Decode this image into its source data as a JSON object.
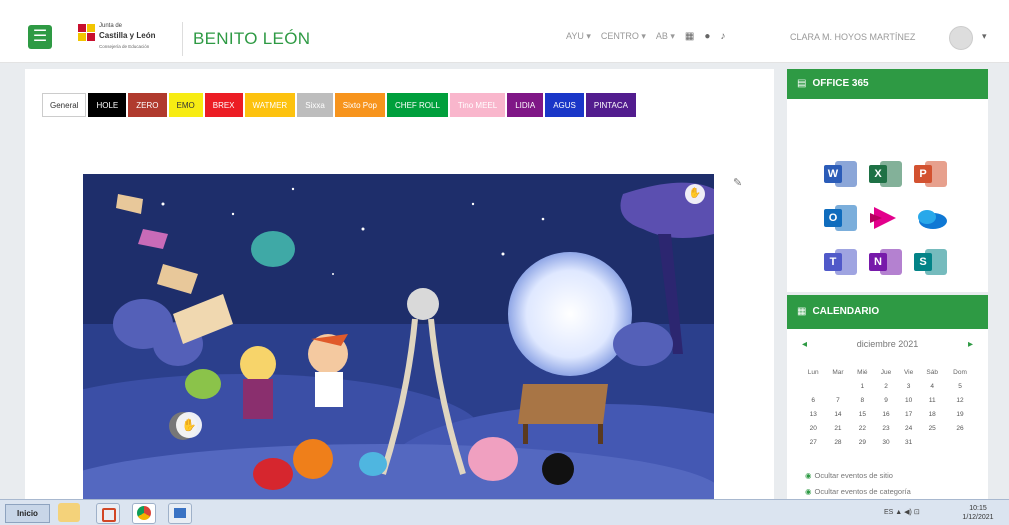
{
  "header": {
    "menu_icon": "hamburger-icon",
    "logo_lines": [
      "Junta de",
      "Castilla y León",
      "Consejería de Educación"
    ],
    "site_title": "BENITO LEÓN",
    "nav_items": [
      "AYU ▾",
      "CENTRO ▾",
      "AB ▾"
    ],
    "nav_icons": [
      "grid-icon",
      "chat-icon",
      "bell-icon"
    ],
    "user_name": "CLARA M. HOYOS MARTÍNEZ",
    "user_caret": "▾"
  },
  "tabs": [
    {
      "label": "General",
      "bg": "#ffffff",
      "fg": "#333333",
      "active": true
    },
    {
      "label": "HOLE",
      "bg": "#000000",
      "fg": "#ffffff"
    },
    {
      "label": "ZERO",
      "bg": "#b03a2e",
      "fg": "#ffffff"
    },
    {
      "label": "EMO",
      "bg": "#f7ec13",
      "fg": "#333333"
    },
    {
      "label": "BREX",
      "bg": "#ec1c24",
      "fg": "#ffffff"
    },
    {
      "label": "WATMER",
      "bg": "#fdc20e",
      "fg": "#ffffff"
    },
    {
      "label": "Sixxa",
      "bg": "#bdbdbd",
      "fg": "#ffffff"
    },
    {
      "label": "Sixto Pop",
      "bg": "#f7941d",
      "fg": "#ffffff"
    },
    {
      "label": "CHEF ROLL",
      "bg": "#009f3c",
      "fg": "#ffffff"
    },
    {
      "label": "Tino MEEL",
      "bg": "#f9b6cc",
      "fg": "#ffffff"
    },
    {
      "label": "LIDIA",
      "bg": "#7f1786",
      "fg": "#ffffff"
    },
    {
      "label": "AGUS",
      "bg": "#1a36c8",
      "fg": "#ffffff"
    },
    {
      "label": "PINTACA",
      "bg": "#521c8e",
      "fg": "#ffffff"
    }
  ],
  "office": {
    "title": "OFFICE 365",
    "icon": "office-icon",
    "apps": [
      {
        "name": "word-icon",
        "letter": "W",
        "color": "#2b5cb8"
      },
      {
        "name": "excel-icon",
        "letter": "X",
        "color": "#1e7145"
      },
      {
        "name": "powerpoint-icon",
        "letter": "P",
        "color": "#d35230"
      },
      {
        "name": "outlook-icon",
        "letter": "O",
        "color": "#0f6cbd"
      },
      {
        "name": "stream-icon",
        "letter": "",
        "color": "#e3008c"
      },
      {
        "name": "onedrive-icon",
        "letter": "",
        "color": "#0f78d4"
      },
      {
        "name": "teams-icon",
        "letter": "T",
        "color": "#5059c9"
      },
      {
        "name": "onenote-icon",
        "letter": "N",
        "color": "#7719aa"
      },
      {
        "name": "sharepoint-icon",
        "letter": "S",
        "color": "#038387"
      }
    ]
  },
  "calendar": {
    "title": "CALENDARIO",
    "icon": "calendar-icon",
    "month": "diciembre 2021",
    "prev": "◂",
    "next": "▸",
    "weekdays": [
      "Lun",
      "Mar",
      "Mié",
      "Jue",
      "Vie",
      "Sáb",
      "Dom"
    ],
    "weeks": [
      [
        "",
        "",
        "1",
        "2",
        "3",
        "4",
        "5"
      ],
      [
        "6",
        "7",
        "8",
        "9",
        "10",
        "11",
        "12"
      ],
      [
        "13",
        "14",
        "15",
        "16",
        "17",
        "18",
        "19"
      ],
      [
        "20",
        "21",
        "22",
        "23",
        "24",
        "25",
        "26"
      ],
      [
        "27",
        "28",
        "29",
        "30",
        "31",
        "",
        ""
      ]
    ],
    "events": [
      "Ocultar eventos de sitio",
      "Ocultar eventos de categoría"
    ]
  },
  "taskbar": {
    "start_label": "Inicio",
    "tray_text": "ES  ▲  ◀)  ⊡",
    "clock_time": "10:15",
    "clock_date": "1/12/2021"
  },
  "colors": {
    "accent": "#2e9a44"
  }
}
